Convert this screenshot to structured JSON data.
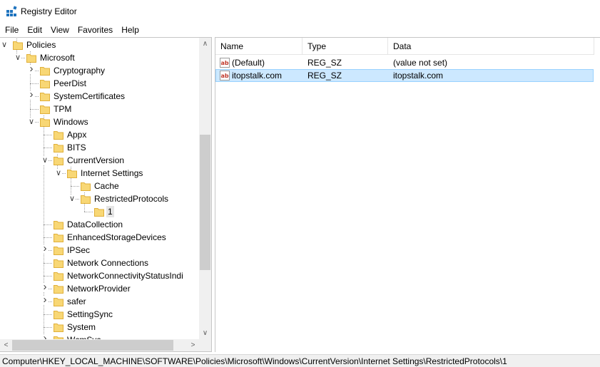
{
  "window": {
    "title": "Registry Editor"
  },
  "menu": {
    "items": [
      "File",
      "Edit",
      "View",
      "Favorites",
      "Help"
    ]
  },
  "tree": {
    "items": [
      {
        "label": "Policies",
        "expander": "expanded"
      },
      {
        "label": "Microsoft",
        "expander": "expanded"
      },
      {
        "label": "Cryptography",
        "expander": "collapsed"
      },
      {
        "label": "PeerDist",
        "expander": "none"
      },
      {
        "label": "SystemCertificates",
        "expander": "collapsed"
      },
      {
        "label": "TPM",
        "expander": "none"
      },
      {
        "label": "Windows",
        "expander": "expanded"
      },
      {
        "label": "Appx",
        "expander": "none"
      },
      {
        "label": "BITS",
        "expander": "none"
      },
      {
        "label": "CurrentVersion",
        "expander": "expanded"
      },
      {
        "label": "Internet Settings",
        "expander": "expanded"
      },
      {
        "label": "Cache",
        "expander": "none"
      },
      {
        "label": "RestrictedProtocols",
        "expander": "expanded"
      },
      {
        "label": "1",
        "expander": "none",
        "selected": true
      },
      {
        "label": "DataCollection",
        "expander": "none"
      },
      {
        "label": "EnhancedStorageDevices",
        "expander": "none"
      },
      {
        "label": "IPSec",
        "expander": "collapsed"
      },
      {
        "label": "Network Connections",
        "expander": "none"
      },
      {
        "label": "NetworkConnectivityStatusIndi",
        "expander": "none"
      },
      {
        "label": "NetworkProvider",
        "expander": "collapsed"
      },
      {
        "label": "safer",
        "expander": "collapsed"
      },
      {
        "label": "SettingSync",
        "expander": "none"
      },
      {
        "label": "System",
        "expander": "none"
      },
      {
        "label": "WcmSvc",
        "expander": "collapsed"
      }
    ]
  },
  "list": {
    "columns": [
      "Name",
      "Type",
      "Data"
    ],
    "rows": [
      {
        "name": "(Default)",
        "type": "REG_SZ",
        "data": "(value not set)",
        "icon": "string-value-icon"
      },
      {
        "name": "itopstalk.com",
        "type": "REG_SZ",
        "data": "itopstalk.com",
        "icon": "string-value-icon",
        "selected": true
      }
    ]
  },
  "status": {
    "path": "Computer\\HKEY_LOCAL_MACHINE\\SOFTWARE\\Policies\\Microsoft\\Windows\\CurrentVersion\\Internet Settings\\RestrictedProtocols\\1"
  },
  "colors": {
    "folder": "#f8d775",
    "folder_edge": "#e0b03a",
    "selection": "#cce8ff",
    "selection_border": "#99d1ff"
  }
}
